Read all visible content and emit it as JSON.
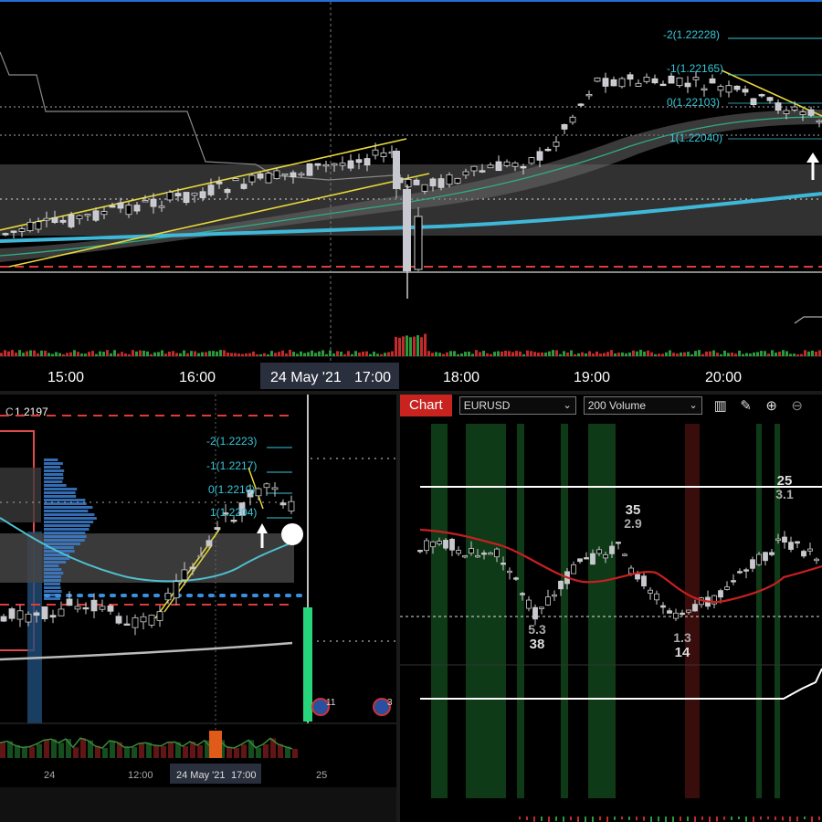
{
  "top_chart": {
    "time_axis": [
      "15:00",
      "16:00",
      "24 May '21",
      "17:00",
      "18:00",
      "19:00",
      "20:00"
    ],
    "fib_levels": [
      {
        "label": "-2(1.22228)"
      },
      {
        "label": "-1(1.22165)"
      },
      {
        "label": "0(1.22103)"
      },
      {
        "label": "1(1.22040)"
      }
    ]
  },
  "bottom_left_chart": {
    "price_label": "1.2197",
    "fib_levels": [
      {
        "label": "-2(1.2223)"
      },
      {
        "label": "-1(1.2217)"
      },
      {
        "label": "0(1.2210)"
      },
      {
        "label": "1(1.2204)"
      }
    ],
    "time_axis": [
      "24",
      "12:00",
      "24 May '21",
      "17:00",
      "25"
    ],
    "flag_badges": [
      "11",
      "3"
    ]
  },
  "bottom_right_chart": {
    "tab_label": "Chart",
    "symbol": "EURUSD",
    "interval": "200 Volume",
    "annotations": [
      {
        "top": "35",
        "bottom": "2.9"
      },
      {
        "top": "25",
        "bottom": "3.1"
      },
      {
        "top": "5.3",
        "bottom": "38"
      },
      {
        "top": "1.3",
        "bottom": "14"
      }
    ]
  }
}
